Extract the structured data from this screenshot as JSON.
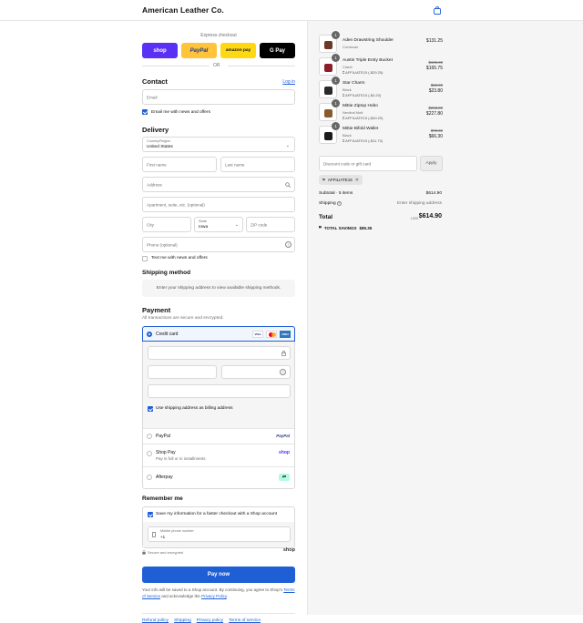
{
  "header": {
    "brand": "American Leather Co.",
    "cart_icon": "shopping-bag-icon"
  },
  "express": {
    "label": "Express checkout",
    "buttons": [
      "shop",
      "PayPal",
      "amazon pay",
      "G Pay"
    ],
    "or": "OR"
  },
  "contact": {
    "title": "Contact",
    "login": "Log in",
    "email_placeholder": "Email",
    "news_label": "Email me with news and offers"
  },
  "delivery": {
    "title": "Delivery",
    "country_label": "Country/Region",
    "country_value": "United States",
    "first_name": "First name",
    "last_name": "Last name",
    "address": "Address",
    "apartment": "Apartment, suite, etc. (optional)",
    "city": "City",
    "state_label": "State",
    "state_value": "Iowa",
    "zip": "ZIP code",
    "phone": "Phone (optional)",
    "text_label": "Text me with news and offers"
  },
  "shipping": {
    "title": "Shipping method",
    "message": "Enter your shipping address to view available shipping methods."
  },
  "payment": {
    "title": "Payment",
    "subtitle": "All transactions are secure and encrypted.",
    "credit_card": "Credit card",
    "card_brands": [
      "VISA",
      "MC",
      "AMEX"
    ],
    "billing_label": "Use shipping address as billing address",
    "paypal": "PayPal",
    "paypal_badge": "PayPal",
    "shop_pay": "Shop Pay",
    "shop_pay_sub": "Pay in full or in installments",
    "shop_pay_badge": "shop",
    "afterpay": "Afterpay"
  },
  "remember": {
    "title": "Remember me",
    "save_label": "Save my information for a faster checkout with a Shop account",
    "phone_label": "Mobile phone number",
    "phone_value": "+1",
    "secure": "Secure and encrypted",
    "shop_logo": "shop"
  },
  "pay_now": "Pay now",
  "legal": {
    "text1": "Your info will be saved to a Shop account. By continuing, you agree to Shop’s",
    "tos": "Terms of Service",
    "and": "and acknowledge the",
    "privacy": "Privacy Policy",
    "end": "."
  },
  "footer_links": [
    "Refund policy",
    "Shipping",
    "Privacy policy",
    "Terms of service"
  ],
  "cart": {
    "items": [
      {
        "qty": "1",
        "name": "Aden Drawstring Shoulder",
        "variant": "Cordovan",
        "discount": "",
        "orig": "",
        "price": "$131.25",
        "color": "#6b3a26"
      },
      {
        "qty": "1",
        "name": "Austin Triple Entry Bucket",
        "variant": "Claret",
        "discount": "AFFILIATE15 (-$29.25)",
        "orig": "$195.00",
        "price": "$165.75",
        "color": "#8a1f2a"
      },
      {
        "qty": "1",
        "name": "Star Charm",
        "variant": "Black",
        "discount": "AFFILIATE15 (-$4.20)",
        "orig": "$28.00",
        "price": "$23.80",
        "color": "#2a2a2a"
      },
      {
        "qty": "1",
        "name": "Mittie Ziptop Hobo",
        "variant": "Nevitral Mutt",
        "discount": "AFFILIATE15 (-$40.20)",
        "orig": "$268.00",
        "price": "$227.80",
        "color": "#8b5a2b"
      },
      {
        "qty": "1",
        "name": "Mittie Bifold Wallet",
        "variant": "Black",
        "discount": "AFFILIATE15 (-$11.70)",
        "orig": "$78.00",
        "price": "$66.30",
        "color": "#1c1c1c"
      }
    ],
    "discount_placeholder": "Discount code or gift card",
    "apply": "Apply",
    "applied_code": "AFFILIATE15",
    "subtotal_label": "Subtotal · 5 items",
    "subtotal": "$614.90",
    "shipping_label": "Shipping",
    "shipping_value": "Enter shipping address",
    "total_label": "Total",
    "currency": "USD",
    "total": "$614.90",
    "savings_label": "TOTAL SAVINGS",
    "savings": "$85.35"
  }
}
